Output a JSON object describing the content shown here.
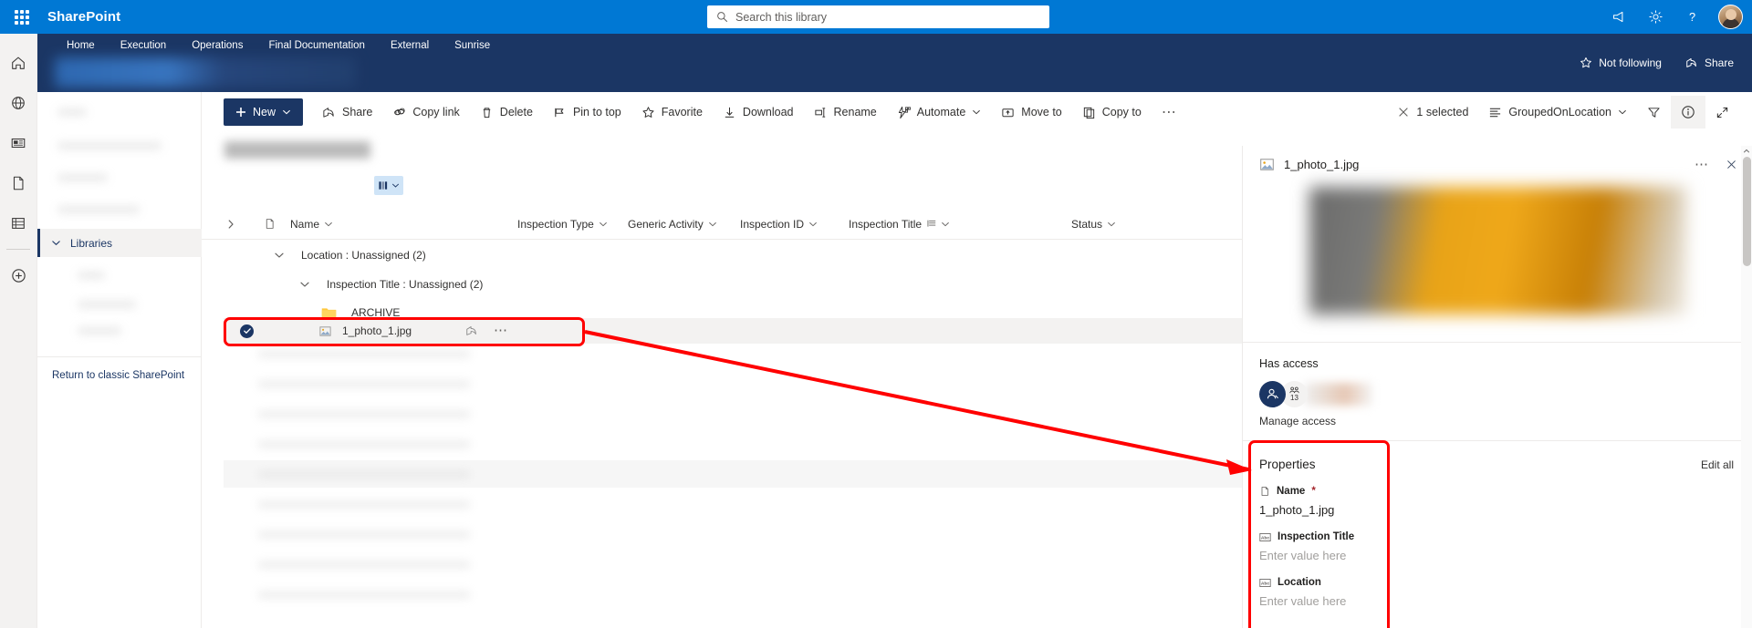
{
  "suite": {
    "brand": "SharePoint",
    "waffle_label": "app-launcher",
    "search_placeholder": "Search this library",
    "icons": {
      "megaphone": "megaphone-icon",
      "settings": "gear-icon",
      "help": "help-icon",
      "account": "account-avatar"
    }
  },
  "sitenav": {
    "items": [
      {
        "label": "Home"
      },
      {
        "label": "Execution"
      },
      {
        "label": "Operations"
      },
      {
        "label": "Final Documentation"
      },
      {
        "label": "External"
      },
      {
        "label": "Sunrise"
      }
    ],
    "follow_label": "Not following",
    "share_label": "Share"
  },
  "rail": {
    "items": [
      "home-icon",
      "globe-icon",
      "news-icon",
      "page-icon",
      "list-icon",
      "create-icon"
    ]
  },
  "leftnav": {
    "libraries_label": "Libraries",
    "classic_link": "Return to classic SharePoint"
  },
  "commandbar": {
    "new_label": "New",
    "items": [
      {
        "label": "Share",
        "icon": "share-icon"
      },
      {
        "label": "Copy link",
        "icon": "link-icon"
      },
      {
        "label": "Delete",
        "icon": "trash-icon"
      },
      {
        "label": "Pin to top",
        "icon": "pin-icon"
      },
      {
        "label": "Favorite",
        "icon": "star-icon"
      },
      {
        "label": "Download",
        "icon": "download-icon"
      },
      {
        "label": "Rename",
        "icon": "rename-icon"
      },
      {
        "label": "Automate",
        "icon": "automate-icon",
        "chevron": true
      },
      {
        "label": "Move to",
        "icon": "move-icon"
      },
      {
        "label": "Copy to",
        "icon": "copy-icon"
      }
    ],
    "overflow_label": "⋯",
    "right": {
      "selected_label": "1 selected",
      "view_label": "GroupedOnLocation",
      "filter_icon": "filter-icon",
      "info_icon": "info-icon",
      "expand_icon": "expand-icon"
    }
  },
  "list": {
    "columns": [
      {
        "label": "Name",
        "sortable": true
      },
      {
        "label": "Inspection Type",
        "sortable": true
      },
      {
        "label": "Generic Activity",
        "sortable": true
      },
      {
        "label": "Inspection ID",
        "sortable": true
      },
      {
        "label": "Inspection Title",
        "sortable": true,
        "grouped": true
      },
      {
        "label": "Status",
        "sortable": true
      }
    ],
    "groups": [
      {
        "label": "Location : Unassigned (2)",
        "level": 1
      },
      {
        "label": "Inspection Title : Unassigned (2)",
        "level": 2
      }
    ],
    "rows": [
      {
        "name": "ARCHIVE",
        "type": "folder",
        "selected": false
      },
      {
        "name": "1_photo_1.jpg",
        "type": "image",
        "selected": true
      }
    ]
  },
  "detail": {
    "file_name": "1_photo_1.jpg",
    "more_label": "⋯",
    "close_label": "✕",
    "has_access": {
      "title": "Has access",
      "count": "13",
      "manage_label": "Manage access"
    },
    "properties": {
      "title": "Properties",
      "edit_all_label": "Edit all",
      "fields": [
        {
          "label": "Name",
          "required": true,
          "value": "1_photo_1.jpg",
          "is_placeholder": false,
          "icon": "file-icon"
        },
        {
          "label": "Inspection Title",
          "required": false,
          "value": "Enter value here",
          "is_placeholder": true,
          "icon": "text-icon"
        },
        {
          "label": "Location",
          "required": false,
          "value": "Enter value here",
          "is_placeholder": true,
          "icon": "text-icon"
        }
      ]
    }
  },
  "annotations": {
    "highlight_file_row": true,
    "highlight_properties": true,
    "arrow_color": "#ff0000"
  },
  "colors": {
    "suite_blue": "#0078d4",
    "site_navy": "#1b3664",
    "accent_red": "#ff0000",
    "row_selected": "#f3f2f1"
  }
}
